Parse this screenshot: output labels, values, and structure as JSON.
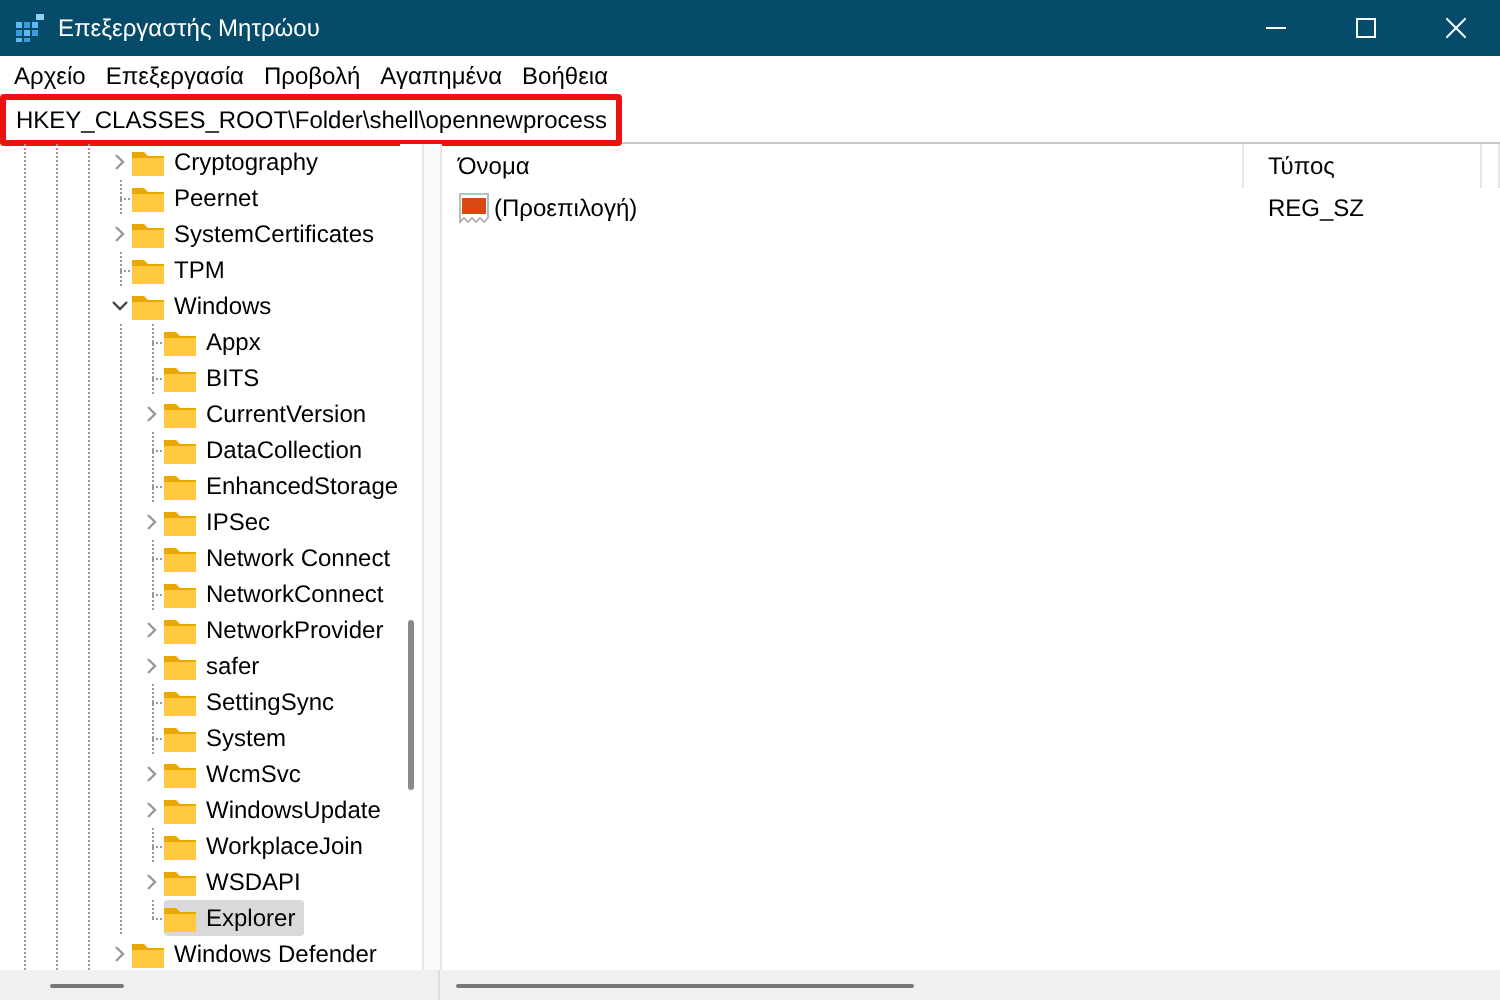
{
  "window": {
    "title": "Επεξεργαστής Μητρώου"
  },
  "menu": [
    "Αρχείο",
    "Επεξεργασία",
    "Προβολή",
    "Αγαπημένα",
    "Βοήθεια"
  ],
  "address": {
    "value": "HKEY_CLASSES_ROOT\\Folder\\shell\\opennewprocess",
    "highlighted": true
  },
  "tree": [
    {
      "label": "Cryptography",
      "kind": "collapsed",
      "selected": false
    },
    {
      "label": "Peernet",
      "kind": "leaf",
      "selected": false
    },
    {
      "label": "SystemCertificates",
      "kind": "collapsed",
      "selected": false
    },
    {
      "label": "TPM",
      "kind": "leaf",
      "selected": false
    },
    {
      "label": "Windows",
      "kind": "expanded",
      "selected": false,
      "children": [
        {
          "label": "Appx",
          "kind": "leaf",
          "selected": false
        },
        {
          "label": "BITS",
          "kind": "leaf",
          "selected": false
        },
        {
          "label": "CurrentVersion",
          "kind": "collapsed",
          "selected": false
        },
        {
          "label": "DataCollection",
          "kind": "leaf",
          "selected": false
        },
        {
          "label": "EnhancedStorage",
          "kind": "leaf",
          "selected": false
        },
        {
          "label": "IPSec",
          "kind": "collapsed",
          "selected": false
        },
        {
          "label": "Network Connect",
          "kind": "leaf",
          "selected": false
        },
        {
          "label": "NetworkConnect",
          "kind": "leaf",
          "selected": false
        },
        {
          "label": "NetworkProvider",
          "kind": "collapsed",
          "selected": false
        },
        {
          "label": "safer",
          "kind": "collapsed",
          "selected": false
        },
        {
          "label": "SettingSync",
          "kind": "leaf",
          "selected": false
        },
        {
          "label": "System",
          "kind": "leaf",
          "selected": false
        },
        {
          "label": "WcmSvc",
          "kind": "collapsed",
          "selected": false
        },
        {
          "label": "WindowsUpdate",
          "kind": "collapsed",
          "selected": false
        },
        {
          "label": "WorkplaceJoin",
          "kind": "leaf",
          "selected": false
        },
        {
          "label": "WSDAPI",
          "kind": "collapsed",
          "selected": false
        },
        {
          "label": "Explorer",
          "kind": "leaf",
          "selected": true
        }
      ]
    },
    {
      "label": "Windows Defender",
      "kind": "collapsed",
      "selected": false
    }
  ],
  "values": {
    "columns": [
      "Όνομα",
      "Τύπος"
    ],
    "rows": [
      {
        "name": "(Προεπιλογή)",
        "type": "REG_SZ"
      }
    ]
  }
}
